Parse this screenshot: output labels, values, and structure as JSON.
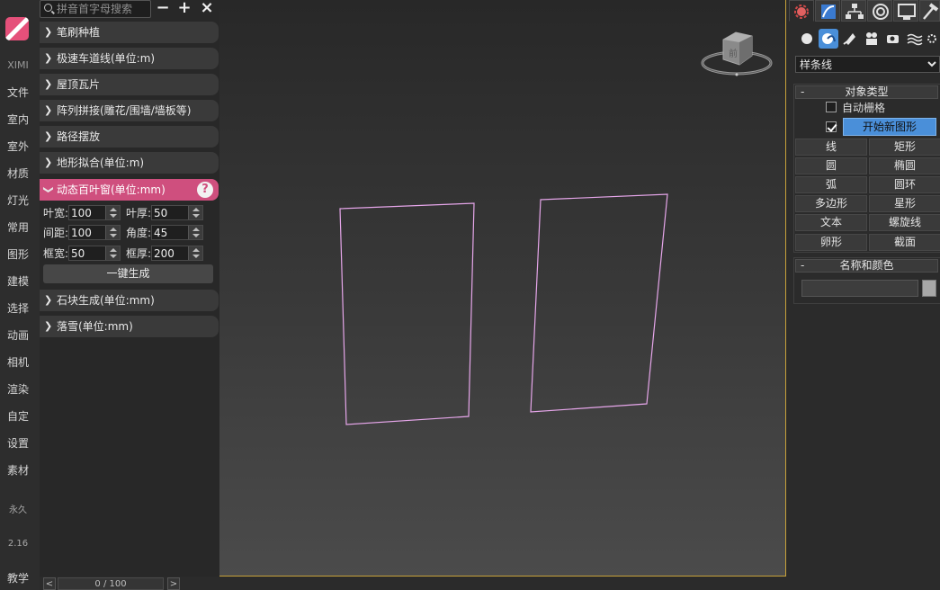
{
  "leftnav": {
    "brand": "XIMI",
    "items": [
      "文件",
      "室内",
      "室外",
      "材质",
      "灯光",
      "常用",
      "图形",
      "建模",
      "选择",
      "动画",
      "相机",
      "渲染",
      "自定",
      "设置",
      "素材"
    ],
    "permanent": "永久",
    "version": "2.16",
    "tutorial": "教学"
  },
  "panel": {
    "search_placeholder": "拼音首字母搜索",
    "buttons": {
      "collapse": "−",
      "add": "+",
      "close": "×"
    },
    "sections": [
      "笔刷种植",
      "极速车道线(单位:m)",
      "屋顶瓦片",
      "阵列拼接(雕花/围墙/墙板等)",
      "路径摆放",
      "地形拟合(单位:m)",
      "动态百叶窗(单位:mm)",
      "石块生成(单位:mm)",
      "落雪(单位:mm)"
    ],
    "help_label": "?",
    "louver": {
      "blade_width_label": "叶宽:",
      "blade_width": "100",
      "blade_thick_label": "叶厚:",
      "blade_thick": "50",
      "spacing_label": "间距:",
      "spacing": "100",
      "angle_label": "角度:",
      "angle": "45",
      "frame_width_label": "框宽:",
      "frame_width": "50",
      "frame_thick_label": "框厚:",
      "frame_thick": "200",
      "generate_label": "一键生成"
    }
  },
  "pager": {
    "prev": "<",
    "next": ">",
    "count": "0 / 100"
  },
  "viewport": {
    "viewcube_label": "前",
    "spline_color": "#e6a6ea"
  },
  "cmdpanel": {
    "shape_type": "样条线",
    "object_type_title": "对象类型",
    "autogrid_label": "自动栅格",
    "start_new_shape_label": "开始新图形",
    "shapes": [
      "线",
      "矩形",
      "圆",
      "椭圆",
      "弧",
      "圆环",
      "多边形",
      "星形",
      "文本",
      "螺旋线",
      "卵形",
      "截面"
    ],
    "name_color_title": "名称和颜色",
    "name_value": "",
    "rollout_minus": "-"
  },
  "colors": {
    "accent": "#cf4f7e",
    "highlight": "#4a8fd9",
    "viewport_border": "#c8a23a"
  }
}
